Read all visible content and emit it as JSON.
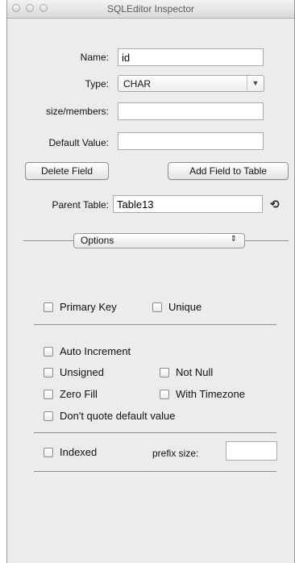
{
  "window": {
    "title": "SQLEditor Inspector"
  },
  "form": {
    "name_label": "Name:",
    "name_value": "id",
    "type_label": "Type:",
    "type_value": "CHAR",
    "size_label": "size/members:",
    "size_value": "",
    "default_label": "Default Value:",
    "default_value": "",
    "delete_button": "Delete Field",
    "add_button": "Add Field to Table",
    "parent_label": "Parent Table:",
    "parent_value": "Table13"
  },
  "options": {
    "popup_label": "Options",
    "primary_key": "Primary Key",
    "unique": "Unique",
    "auto_increment": "Auto Increment",
    "unsigned": "Unsigned",
    "not_null": "Not Null",
    "zero_fill": "Zero Fill",
    "with_timezone": "With Timezone",
    "dont_quote": "Don't quote default value",
    "indexed": "Indexed",
    "prefix_label": "prefix size:",
    "prefix_value": ""
  }
}
